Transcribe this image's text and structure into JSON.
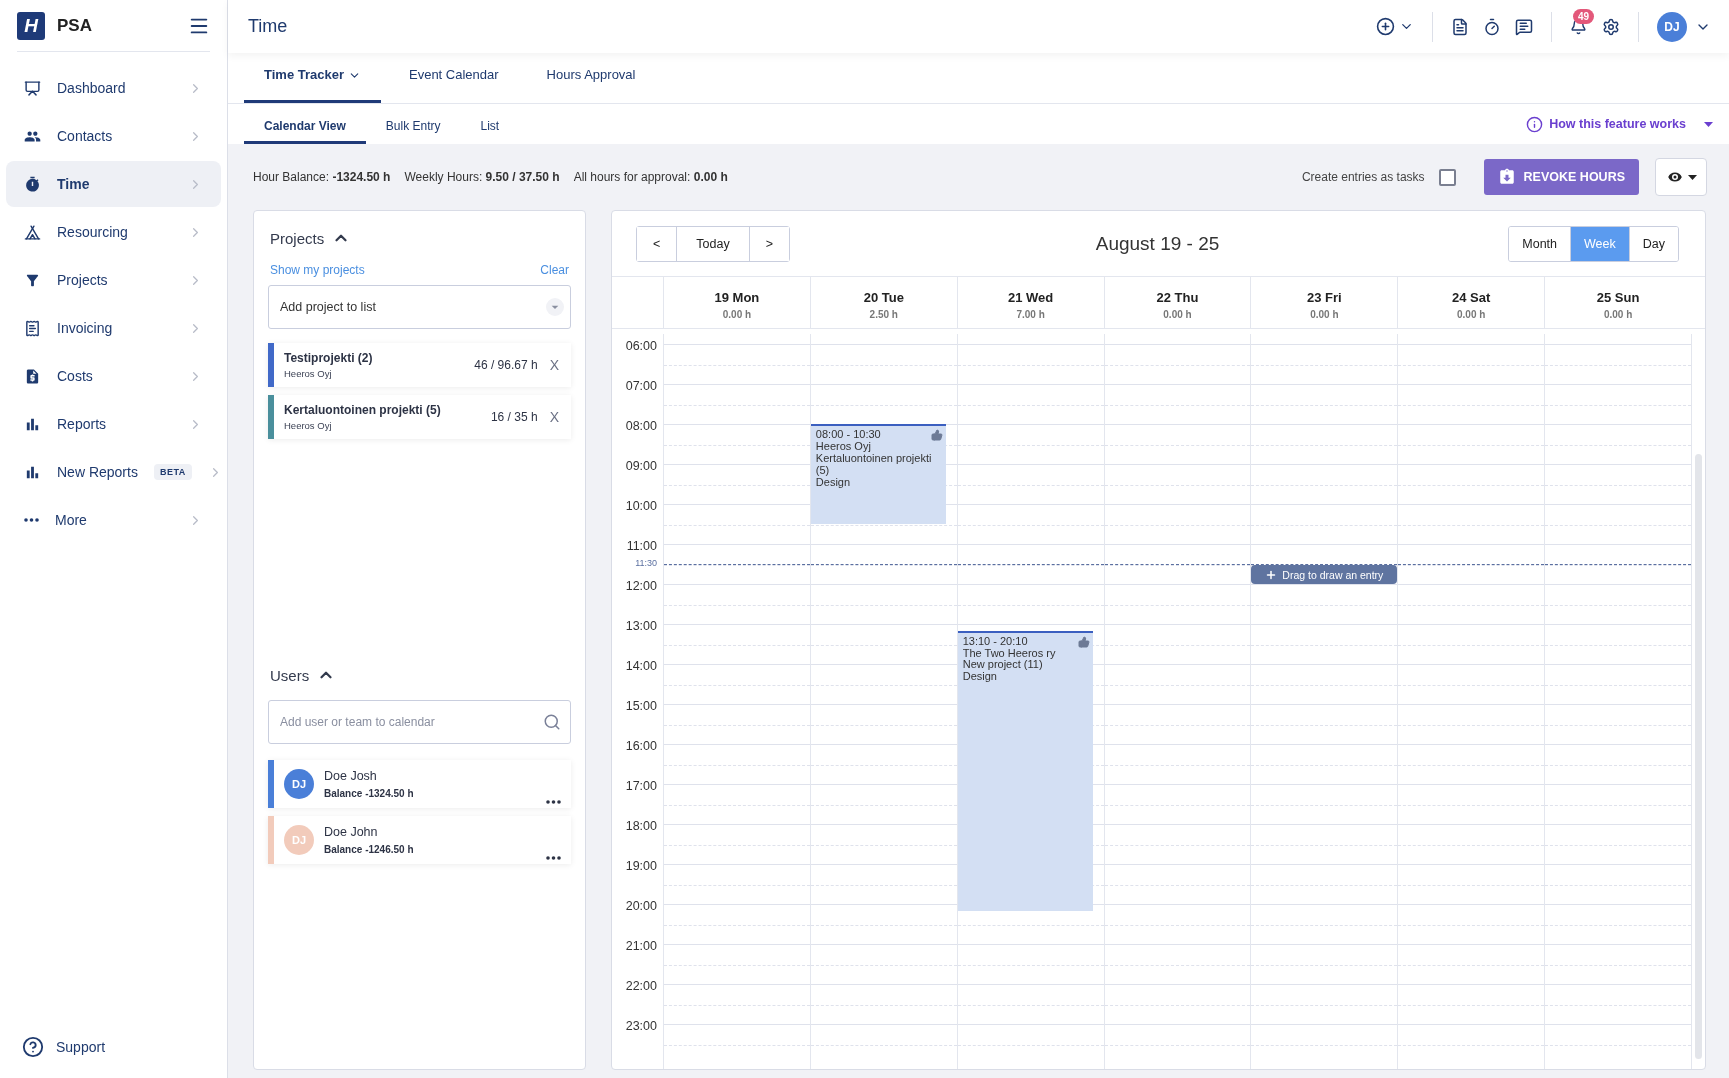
{
  "sidebar": {
    "logo_mark": "H",
    "logo_text": "PSA",
    "items": [
      {
        "label": "Dashboard",
        "selected": false
      },
      {
        "label": "Contacts",
        "selected": false
      },
      {
        "label": "Time",
        "selected": true
      },
      {
        "label": "Resourcing",
        "selected": false
      },
      {
        "label": "Projects",
        "selected": false
      },
      {
        "label": "Invoicing",
        "selected": false
      },
      {
        "label": "Costs",
        "selected": false
      },
      {
        "label": "Reports",
        "selected": false
      },
      {
        "label": "New Reports",
        "selected": false,
        "badge": "BETA"
      },
      {
        "label": "More",
        "selected": false
      }
    ],
    "support": "Support"
  },
  "topbar": {
    "title": "Time",
    "notifications": "49",
    "avatar": "DJ"
  },
  "tabs": [
    {
      "label": "Time Tracker",
      "selected": true,
      "has_menu": true
    },
    {
      "label": "Event Calendar",
      "selected": false,
      "has_menu": false
    },
    {
      "label": "Hours Approval",
      "selected": false,
      "has_menu": false
    }
  ],
  "subtabs": [
    {
      "label": "Calendar View",
      "selected": true
    },
    {
      "label": "Bulk Entry",
      "selected": false
    },
    {
      "label": "List",
      "selected": false
    }
  ],
  "help_link": "How this feature works",
  "toolbar": {
    "stats": [
      "Hour Balance: **-1324.50 h**",
      "Weekly Hours: **9.50 / 37.50 h**",
      "All hours for approval: **0.00 h**"
    ],
    "tasks_checkbox": {
      "label": "Create entries as tasks",
      "checked": false
    },
    "revoke_button": "REVOKE HOURS"
  },
  "projects": {
    "title": "Projects",
    "show_mine": "Show my projects",
    "clear": "Clear",
    "select": {
      "placeholder": "Add project to list"
    },
    "items": [
      {
        "name": "Testiprojekti (2)",
        "company": "Heeros Oyj",
        "hours": "46 / 96.67 h",
        "remove": "X",
        "color": "#4169c8"
      },
      {
        "name": "Kertaluontoinen projekti (5)",
        "company": "Heeros Oyj",
        "hours": "16 / 35 h",
        "remove": "X",
        "color": "#4a8f9c"
      }
    ]
  },
  "users": {
    "title": "Users",
    "search": {
      "placeholder": "Add user or team to calendar"
    },
    "items": [
      {
        "initials": "DJ",
        "name": "Doe Josh",
        "balance": "Balance -1324.50 h",
        "color": "#4a7fd8"
      },
      {
        "initials": "DJ",
        "name": "Doe John",
        "balance": "Balance -1246.50 h",
        "color": "#f2cbbb"
      }
    ]
  },
  "calendar": {
    "prev": "<",
    "today": "Today",
    "next": ">",
    "title": "August 19 - 25",
    "views": [
      {
        "label": "Month",
        "selected": false
      },
      {
        "label": "Week",
        "selected": true
      },
      {
        "label": "Day",
        "selected": false
      }
    ],
    "hours": [
      "06:00",
      "07:00",
      "08:00",
      "09:00",
      "10:00",
      "11:00",
      "12:00",
      "13:00",
      "14:00",
      "15:00",
      "16:00",
      "17:00",
      "18:00",
      "19:00",
      "20:00",
      "21:00",
      "22:00",
      "23:00"
    ],
    "now": "11:30",
    "days": [
      {
        "label": "19 Mon",
        "total": "0.00 h"
      },
      {
        "label": "20 Tue",
        "total": "2.50 h",
        "entries": [
          {
            "time": "08:00 - 10:30",
            "lines": [
              "Heeros Oyj",
              "Kertaluontoinen projekti (5)",
              "Design"
            ]
          }
        ]
      },
      {
        "label": "21 Wed",
        "total": "7.00 h",
        "entries": [
          {
            "time": "13:10 - 20:10",
            "lines": [
              "The Two Heeros ry",
              "New project (11)",
              "Design"
            ]
          }
        ]
      },
      {
        "label": "22 Thu",
        "total": "0.00 h"
      },
      {
        "label": "23 Fri",
        "total": "0.00 h",
        "hint": "Drag to draw an entry"
      },
      {
        "label": "24 Sat",
        "total": "0.00 h"
      },
      {
        "label": "25 Sun",
        "total": "0.00 h"
      }
    ]
  }
}
